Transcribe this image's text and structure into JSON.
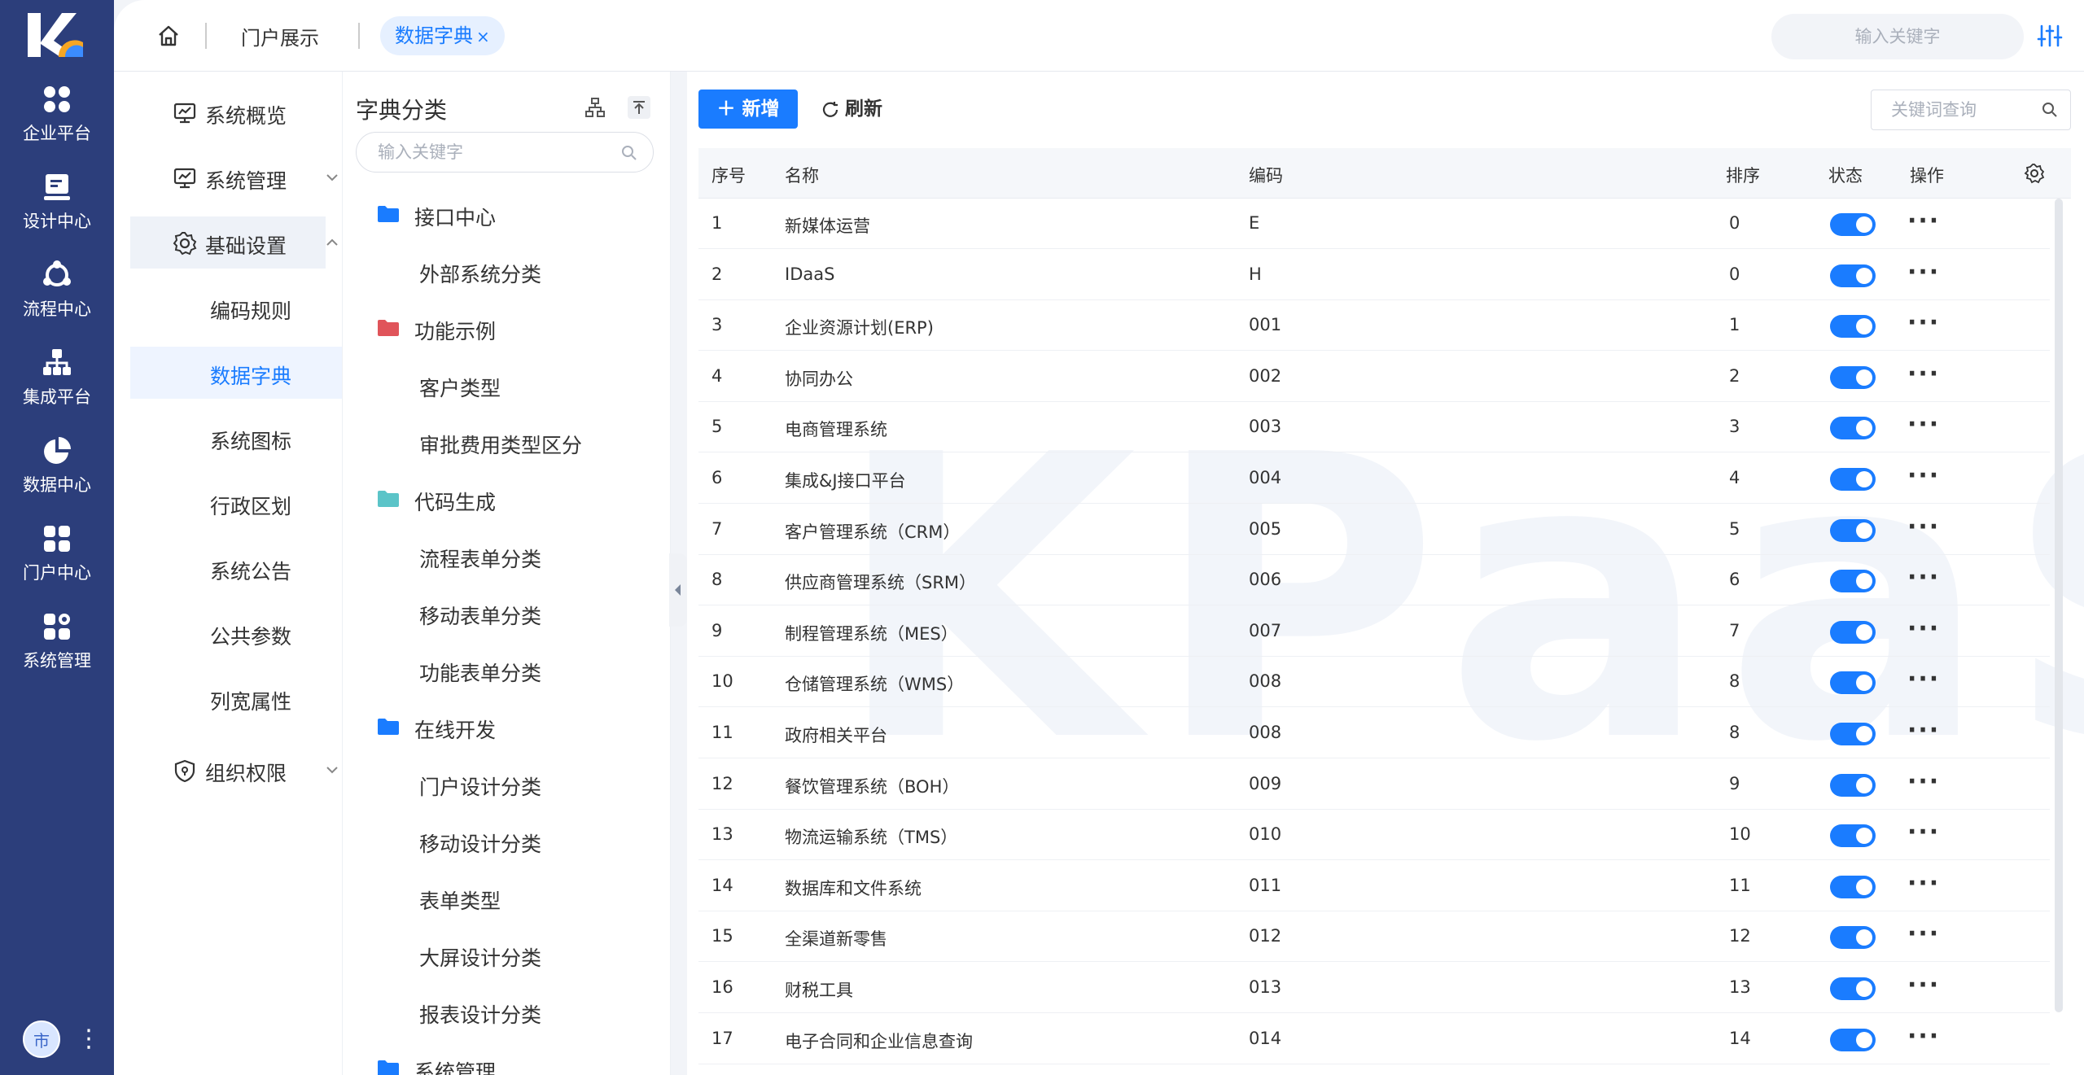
{
  "rail": {
    "items": [
      {
        "label": "企业平台",
        "icon": "grid-icon"
      },
      {
        "label": "设计中心",
        "icon": "design-icon"
      },
      {
        "label": "流程中心",
        "icon": "flow-icon"
      },
      {
        "label": "集成平台",
        "icon": "integration-icon"
      },
      {
        "label": "数据中心",
        "icon": "pie-icon"
      },
      {
        "label": "门户中心",
        "icon": "portal-icon"
      },
      {
        "label": "系统管理",
        "icon": "system-icon"
      }
    ],
    "avatar": "市"
  },
  "topbar": {
    "tab_portal": "门户展示",
    "tab_active": "数据字典",
    "tab_close": "×",
    "search_placeholder": "输入关键字"
  },
  "sidebar": {
    "groups": [
      {
        "label": "系统概览"
      },
      {
        "label": "系统管理"
      },
      {
        "label": "基础设置"
      },
      {
        "label": "组织权限"
      }
    ],
    "subitems": [
      {
        "label": "编码规则"
      },
      {
        "label": "数据字典"
      },
      {
        "label": "系统图标"
      },
      {
        "label": "行政区划"
      },
      {
        "label": "系统公告"
      },
      {
        "label": "公共参数"
      },
      {
        "label": "列宽属性"
      }
    ]
  },
  "catpanel": {
    "title": "字典分类",
    "search_placeholder": "输入关键字",
    "items": [
      {
        "label": "接口中心",
        "folder": "#1a7cff"
      },
      {
        "label": "外部系统分类"
      },
      {
        "label": "功能示例",
        "folder": "#e0545a"
      },
      {
        "label": "客户类型"
      },
      {
        "label": "审批费用类型区分"
      },
      {
        "label": "代码生成",
        "folder": "#5bc4c8"
      },
      {
        "label": "流程表单分类"
      },
      {
        "label": "移动表单分类"
      },
      {
        "label": "功能表单分类"
      },
      {
        "label": "在线开发",
        "folder": "#1a7cff"
      },
      {
        "label": "门户设计分类"
      },
      {
        "label": "移动设计分类"
      },
      {
        "label": "表单类型"
      },
      {
        "label": "大屏设计分类"
      },
      {
        "label": "报表设计分类"
      },
      {
        "label": "系统管理",
        "folder": "#1a7cff"
      }
    ]
  },
  "main": {
    "add_label": "新增",
    "refresh_label": "刷新",
    "search_placeholder": "关键词查询",
    "watermark": "KPaaS",
    "columns": [
      "序号",
      "名称",
      "编码",
      "排序",
      "状态",
      "操作"
    ],
    "rows": [
      {
        "no": "1",
        "name": "新媒体运营",
        "code": "E",
        "sort": "0"
      },
      {
        "no": "2",
        "name": "IDaaS",
        "code": "H",
        "sort": "0"
      },
      {
        "no": "3",
        "name": "企业资源计划(ERP)",
        "code": "001",
        "sort": "1"
      },
      {
        "no": "4",
        "name": "协同办公",
        "code": "002",
        "sort": "2"
      },
      {
        "no": "5",
        "name": "电商管理系统",
        "code": "003",
        "sort": "3"
      },
      {
        "no": "6",
        "name": "集成&J接口平台",
        "code": "004",
        "sort": "4"
      },
      {
        "no": "7",
        "name": "客户管理系统（CRM）",
        "code": "005",
        "sort": "5"
      },
      {
        "no": "8",
        "name": "供应商管理系统（SRM）",
        "code": "006",
        "sort": "6"
      },
      {
        "no": "9",
        "name": "制程管理系统（MES）",
        "code": "007",
        "sort": "7"
      },
      {
        "no": "10",
        "name": "仓储管理系统（WMS）",
        "code": "008",
        "sort": "8"
      },
      {
        "no": "11",
        "name": "政府相关平台",
        "code": "008",
        "sort": "8"
      },
      {
        "no": "12",
        "name": "餐饮管理系统（BOH）",
        "code": "009",
        "sort": "9"
      },
      {
        "no": "13",
        "name": "物流运输系统（TMS）",
        "code": "010",
        "sort": "10"
      },
      {
        "no": "14",
        "name": "数据库和文件系统",
        "code": "011",
        "sort": "11"
      },
      {
        "no": "15",
        "name": "全渠道新零售",
        "code": "012",
        "sort": "12"
      },
      {
        "no": "16",
        "name": "财税工具",
        "code": "013",
        "sort": "13"
      },
      {
        "no": "17",
        "name": "电子合同和企业信息查询",
        "code": "014",
        "sort": "14"
      }
    ]
  },
  "colors": {
    "accent": "#1a7cff",
    "rail": "#2c3e7b"
  }
}
